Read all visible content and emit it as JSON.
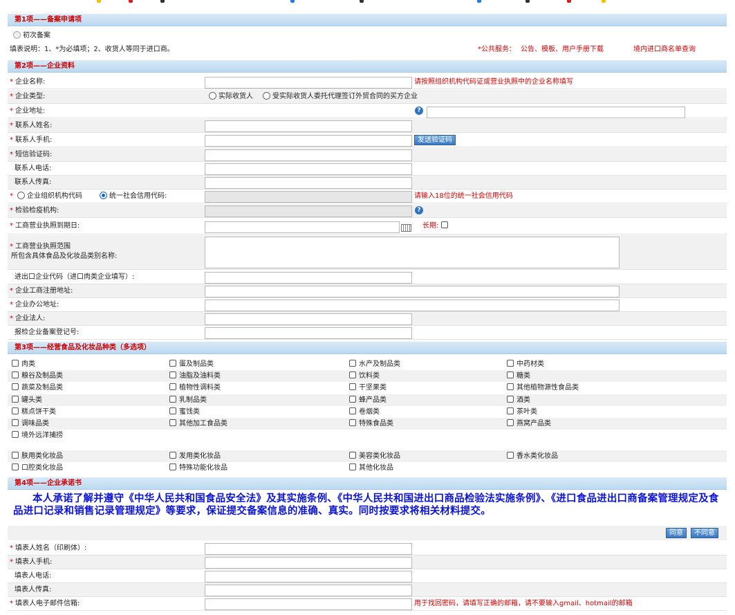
{
  "section1": {
    "title": "第1项——备案申请项",
    "first_filing": "初次备案",
    "note": "填表说明：1、*为必填项；2、收货人等同于进口商。",
    "public_service_label": "*公共服务：",
    "public_service_link": "公告、模板、用户手册下载",
    "query_link": "境内进口商名单查询"
  },
  "section2": {
    "title": "第2项——企业资料",
    "company_name": "企业名称:",
    "company_name_hint": "请按照组织机构代码证或营业执照中的企业名称填写",
    "company_type": "企业类型:",
    "type_option1": "实际收货人",
    "type_option2": "受实际收货人委托代理签订外贸合同的买方企业",
    "company_address": "企业地址:",
    "contact_name": "联系人姓名:",
    "contact_mobile": "联系人手机:",
    "send_code_button": "发送验证码",
    "sms_code": "短信验证码:",
    "contact_phone": "联系人电话:",
    "contact_fax": "联系人传真:",
    "org_code_option": "企业组织机构代码",
    "credit_code_option": "统一社会信用代码:",
    "credit_code_hint": "请输入18位的统一社会信用代码",
    "inspection_agency": "检验检疫机构:",
    "license_expiry": "工商营业执照到期日:",
    "long_term": "长期:",
    "license_scope_line1": "工商营业执照范围",
    "license_scope_line2": "所包含具体食品及化妆品类别名称:",
    "import_export_code": "进出口企业代码（进口肉类企业填写）:",
    "registered_address": "企业工商注册地址:",
    "office_address": "企业办公地址:",
    "legal_person": "企业法人:",
    "inspection_record_no": "报检企业备案登记号:"
  },
  "section3": {
    "title": "第3项——经营食品及化妆品种类（多选项）",
    "food_rows": [
      [
        "肉类",
        "蛋及制品类",
        "水产及制品类",
        "中药材类"
      ],
      [
        "粮谷及制品类",
        "油脂及油料类",
        "饮料类",
        "糖类"
      ],
      [
        "蔬菜及制品类",
        "植物性调料类",
        "干坚果类",
        "其他植物源性食品类"
      ],
      [
        "罐头类",
        "乳制品类",
        "蜂产品类",
        "酒类"
      ],
      [
        "糕点饼干类",
        "蜜饯类",
        "卷烟类",
        "茶叶类"
      ],
      [
        "调味品类",
        "其他加工食品类",
        "特殊食品类",
        "燕窝产品类"
      ],
      [
        "境外远洋捕捞"
      ]
    ],
    "cosmetic_rows": [
      [
        "肤用类化妆品",
        "发用类化妆品",
        "美容类化妆品",
        "香水类化妆品"
      ],
      [
        "口腔类化妆品",
        "特殊功能化妆品",
        "其他化妆品"
      ]
    ]
  },
  "section4": {
    "title": "第4项——企业承诺书",
    "promise_text": "本人承诺了解并遵守《中华人民共和国食品安全法》及其实施条例、《中华人民共和国进出口商品检验法实施条例》、《进口食品进出口商备案管理规定及食品进口记录和销售记录管理规定》等要求，保证提交备案信息的准确、真实。同时按要求将相关材料提交。",
    "agree_button": "同意",
    "disagree_button": "不同意",
    "filler_name": "填表人姓名（印刷体）:",
    "filler_mobile": "填表人手机:",
    "filler_phone": "填表人电话:",
    "filler_fax": "填表人传真:",
    "filler_email": "填表人电子邮件信箱:",
    "email_hint": "用于找回密码，请填写正确的邮箱，请不要输入gmail、hotmail的邮箱"
  },
  "required_mark": "*",
  "colors": {
    "header_bg": "#c9e1f5",
    "header_text": "#cc0000",
    "hint": "#d60000",
    "promise": "#0b14d8"
  }
}
